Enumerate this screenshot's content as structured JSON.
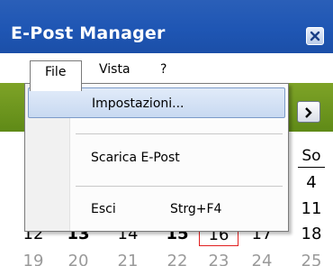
{
  "window": {
    "title": "E-Post Manager"
  },
  "titlebar": {
    "close_icon": "close-x-icon"
  },
  "menubar": {
    "file": "File",
    "vista": "Vista",
    "help": "?"
  },
  "file_menu": {
    "items": [
      {
        "label": "Impostazioni...",
        "shortcut": ""
      },
      {
        "label": "Scarica E-Post",
        "shortcut": ""
      },
      {
        "label": "Esci",
        "shortcut": "Strg+F4"
      }
    ]
  },
  "nav": {
    "next_icon": "chevron-right-icon"
  },
  "calendar": {
    "day_header": "So",
    "rows": [
      {
        "cells": [
          "4"
        ]
      },
      {
        "cells": [
          "11"
        ]
      },
      {
        "cells": [
          "12",
          "13",
          "14",
          "15",
          "16",
          "17",
          "18"
        ]
      },
      {
        "cells": [
          "19",
          "20",
          "21",
          "22",
          "23",
          "24",
          "25"
        ]
      }
    ],
    "today": "16",
    "colors": {
      "today_border": "#e12020",
      "titlebar": "#1f56b4",
      "band": "#6f9620"
    }
  }
}
